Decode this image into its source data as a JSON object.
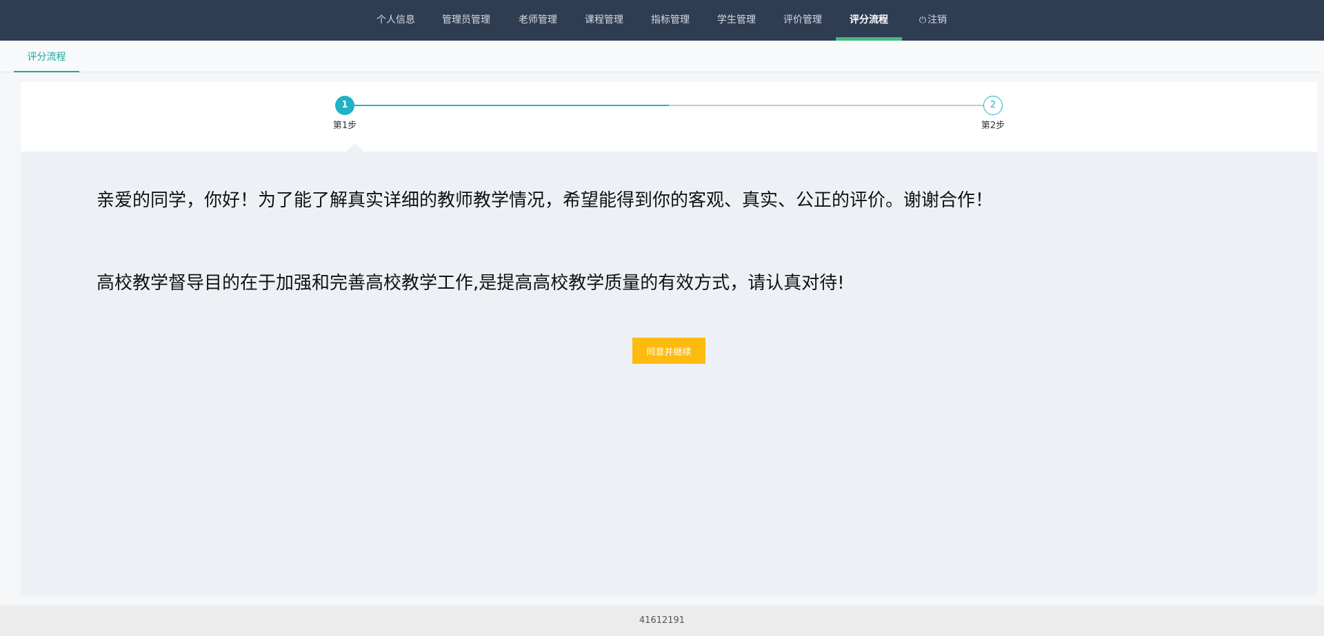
{
  "nav": {
    "items": [
      {
        "label": "个人信息"
      },
      {
        "label": "管理员管理"
      },
      {
        "label": "老师管理"
      },
      {
        "label": "课程管理"
      },
      {
        "label": "指标管理"
      },
      {
        "label": "学生管理"
      },
      {
        "label": "评价管理"
      },
      {
        "label": "评分流程",
        "active": true
      },
      {
        "label": "注销",
        "icon": "power-icon"
      }
    ]
  },
  "tabs": {
    "items": [
      {
        "label": "评分流程",
        "active": true
      }
    ]
  },
  "steps": {
    "progress": 0.5,
    "items": [
      {
        "number": "1",
        "label": "第1步",
        "state": "done"
      },
      {
        "number": "2",
        "label": "第2步",
        "state": "todo"
      }
    ]
  },
  "content": {
    "paragraph1": "亲爱的同学，你好！为了能了解真实详细的教师教学情况，希望能得到你的客观、真实、公正的评价。谢谢合作！",
    "paragraph2": "高校教学督导目的在于加强和完善高校教学工作,是提高高校教学质量的有效方式，请认真对待!",
    "button_label": "同意并继续"
  },
  "footer": {
    "text": "41612191"
  },
  "colors": {
    "nav_bg": "#2f3d53",
    "nav_active_underline": "#47b881",
    "step_accent": "#1fb3c4",
    "button_bg": "#fdbb10",
    "content_bg": "#edf1f6"
  }
}
